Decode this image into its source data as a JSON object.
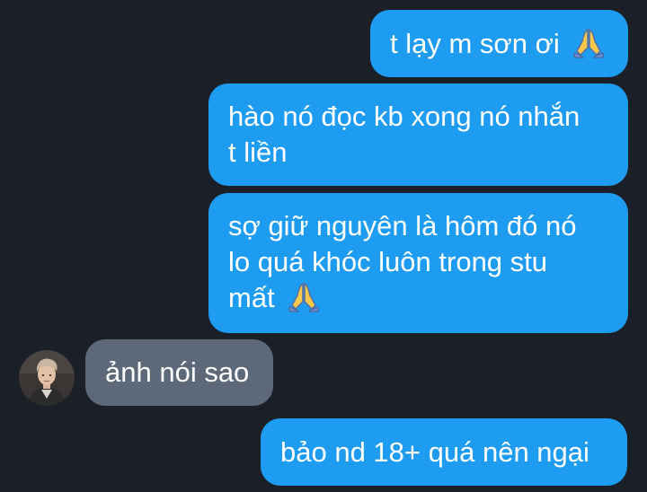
{
  "chat": {
    "messages": [
      {
        "direction": "outgoing",
        "text": "t lạy m sơn ơi ",
        "emoji": "folded-hands-icon"
      },
      {
        "direction": "outgoing",
        "text": "hào nó đọc kb xong nó nhắn\nt liền"
      },
      {
        "direction": "outgoing",
        "text": "sợ giữ nguyên là hôm đó nó\nlo quá khóc luôn trong stu\nmất ",
        "emoji": "folded-hands-icon"
      },
      {
        "direction": "incoming",
        "text": "ảnh nói sao"
      },
      {
        "direction": "outgoing",
        "text": "bảo nd 18+ quá nên ngại"
      }
    ]
  },
  "colors": {
    "background": "#1b1f28",
    "outgoing_bubble": "#1e9cf2",
    "incoming_bubble": "#5d6879",
    "text": "#ffffff"
  }
}
